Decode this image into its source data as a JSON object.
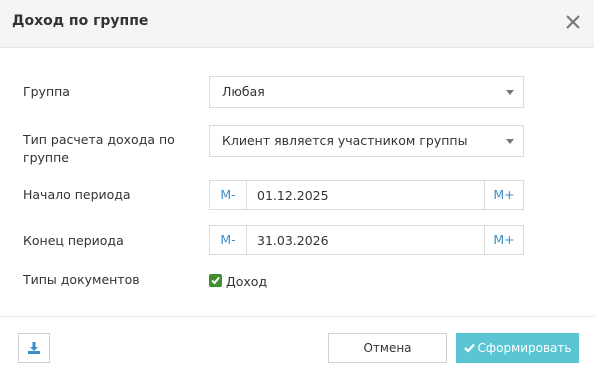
{
  "dialog": {
    "title": "Доход по группе",
    "close_icon": "close-icon"
  },
  "fields": {
    "group": {
      "label": "Группа",
      "value": "Любая"
    },
    "income_type": {
      "label_line1": "Тип расчета дохода по",
      "label_line2": "группе",
      "value": "Клиент является участником группы"
    },
    "period_start": {
      "label": "Начало периода",
      "minus_label": "М-",
      "value": "01.12.2025",
      "plus_label": "М+"
    },
    "period_end": {
      "label": "Конец периода",
      "minus_label": "М-",
      "value": "31.03.2026",
      "plus_label": "М+"
    },
    "doc_types": {
      "label": "Типы документов",
      "checkbox_label": "Доход",
      "checked": true
    }
  },
  "footer": {
    "download_icon": "download-icon",
    "cancel_label": "Отмена",
    "submit_label": "Сформировать"
  },
  "colors": {
    "accent": "#5bc5d3",
    "link": "#3a8fc8",
    "checkbox": "#3f8f2f"
  }
}
